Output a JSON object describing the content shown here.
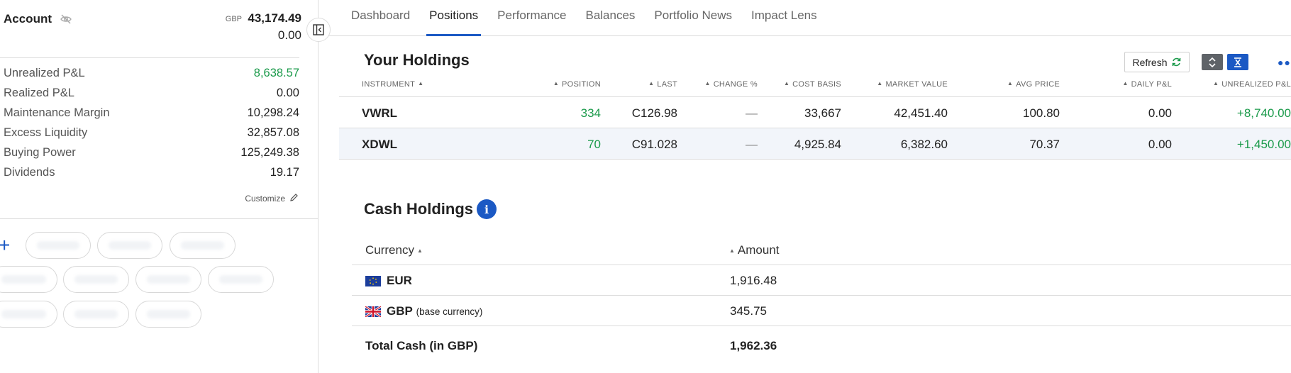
{
  "account": {
    "title": "Account",
    "currency": "GBP",
    "balance": "43,174.49",
    "sub_value": "0.00",
    "icon": "eye-off-icon"
  },
  "metrics": [
    {
      "label": "Unrealized P&L",
      "value": "8,638.57",
      "color": "#1a9a4a"
    },
    {
      "label": "Realized P&L",
      "value": "0.00"
    },
    {
      "label": "Maintenance Margin",
      "value": "10,298.24"
    },
    {
      "label": "Excess Liquidity",
      "value": "32,857.08"
    },
    {
      "label": "Buying Power",
      "value": "125,249.38"
    },
    {
      "label": "Dividends",
      "value": "19.17"
    }
  ],
  "customize_label": "Customize",
  "tabs": [
    {
      "label": "Dashboard",
      "active": false
    },
    {
      "label": "Positions",
      "active": true
    },
    {
      "label": "Performance",
      "active": false
    },
    {
      "label": "Balances",
      "active": false
    },
    {
      "label": "Portfolio News",
      "active": false
    },
    {
      "label": "Impact Lens",
      "active": false
    }
  ],
  "holdings": {
    "title": "Your Holdings",
    "refresh_label": "Refresh",
    "columns": [
      "INSTRUMENT",
      "POSITION",
      "LAST",
      "CHANGE %",
      "COST BASIS",
      "MARKET VALUE",
      "AVG PRICE",
      "DAILY P&L",
      "UNREALIZED P&L"
    ],
    "rows": [
      {
        "instrument": "VWRL",
        "position": "334",
        "last": "C126.98",
        "change": "—",
        "cost_basis": "33,667",
        "market_value": "42,451.40",
        "avg_price": "100.80",
        "daily_pnl": "0.00",
        "unrealized_pnl": "+8,740.00"
      },
      {
        "instrument": "XDWL",
        "position": "70",
        "last": "C91.028",
        "change": "—",
        "cost_basis": "4,925.84",
        "market_value": "6,382.60",
        "avg_price": "70.37",
        "daily_pnl": "0.00",
        "unrealized_pnl": "+1,450.00"
      }
    ]
  },
  "cash": {
    "title": "Cash Holdings",
    "columns": [
      "Currency",
      "Amount"
    ],
    "rows": [
      {
        "currency": "EUR",
        "note": "",
        "amount": "1,916.48",
        "flag": "eu-flag-icon"
      },
      {
        "currency": "GBP",
        "note": "(base currency)",
        "amount": "345.75",
        "flag": "uk-flag-icon"
      }
    ],
    "total_label": "Total Cash (in GBP)",
    "total_value": "1,962.36"
  },
  "colors": {
    "accent": "#1b59c4",
    "positive": "#1a9a4a"
  }
}
